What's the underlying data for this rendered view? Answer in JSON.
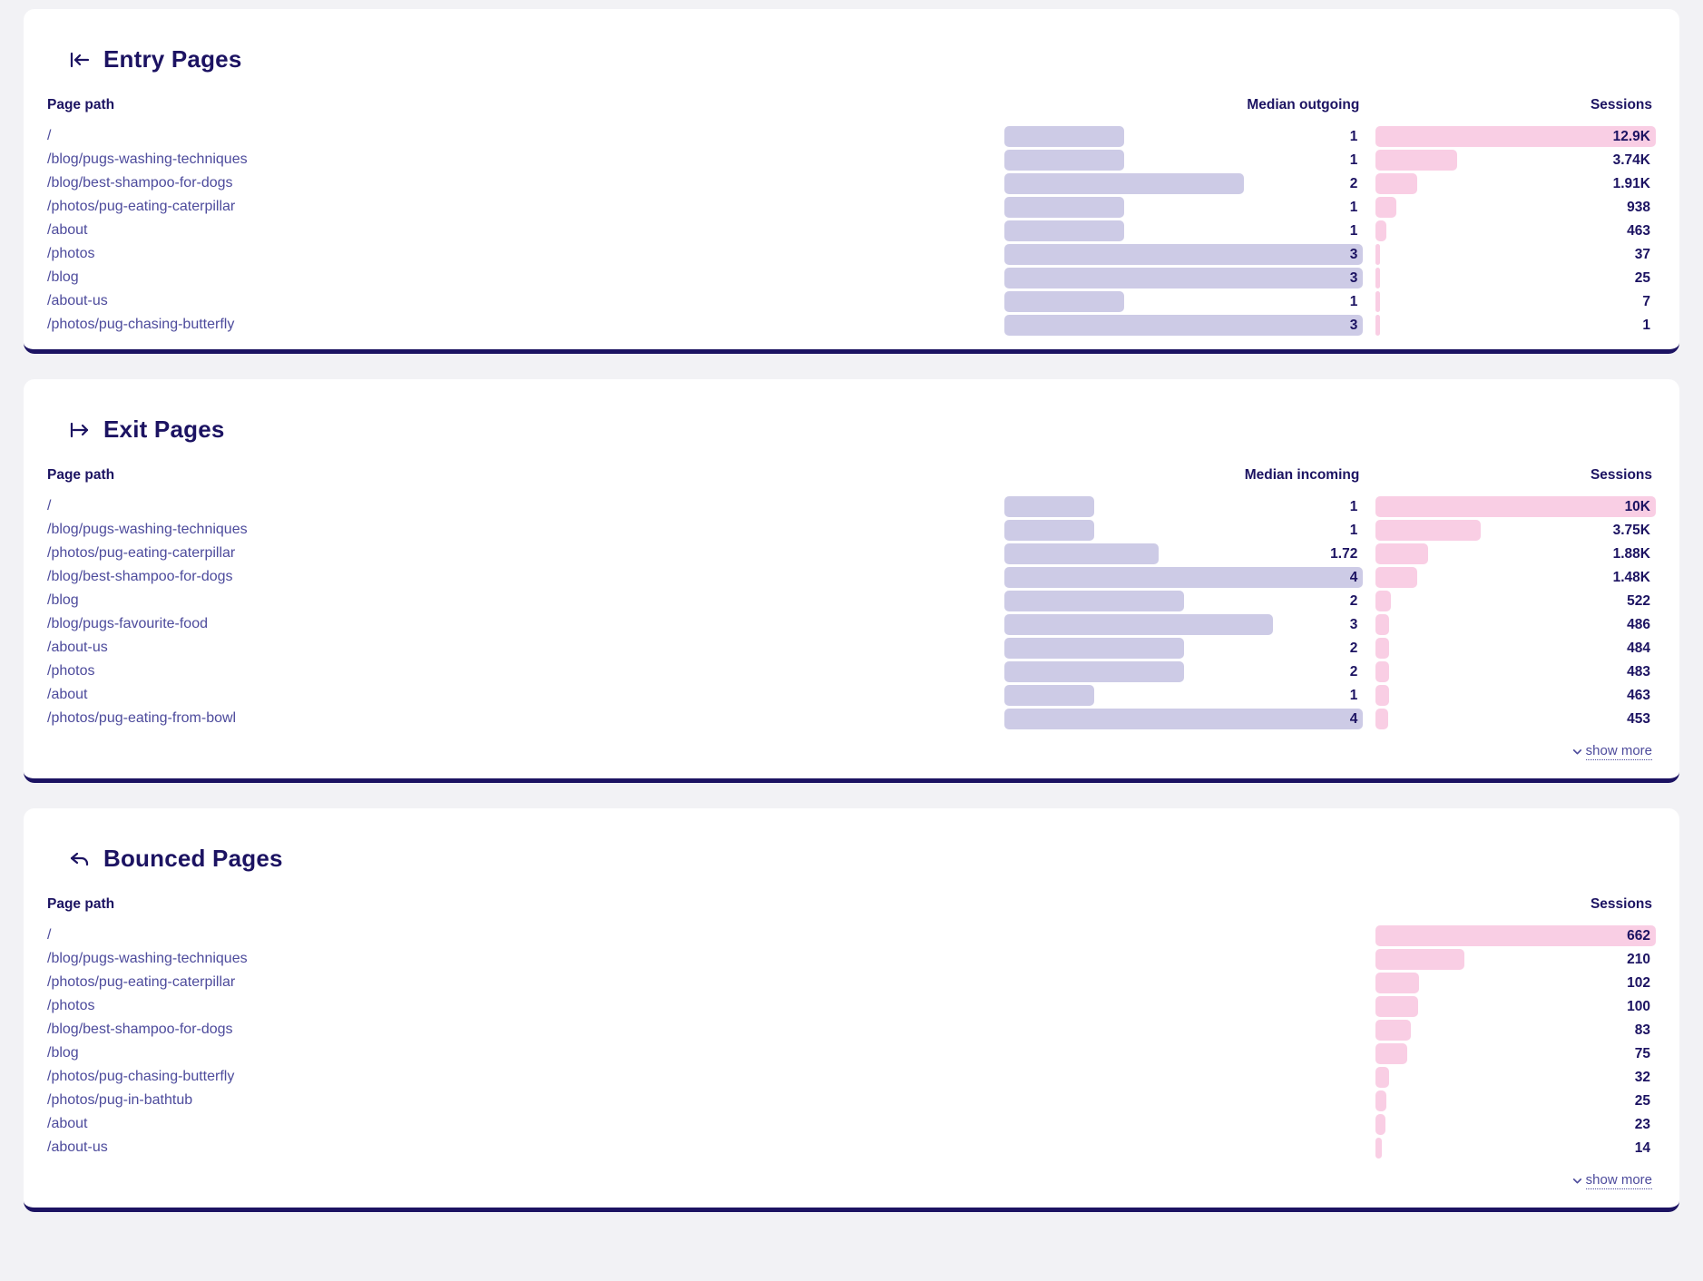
{
  "theme": {
    "page_bg": "#f2f2f5",
    "card_bg": "#ffffff",
    "accent_navy": "#1c1362",
    "path_text": "#4d4b9c",
    "metric_bar": "#cdcbe6",
    "sessions_bar": "#f9cee4",
    "card_bottom_border": "#1c1362"
  },
  "sections": [
    {
      "id": "entry-pages",
      "title": "Entry Pages",
      "icon": "arrow-into-bar-left-icon",
      "columns": {
        "path": "Page path",
        "metric": "Median outgoing",
        "sessions": "Sessions"
      },
      "metric_max": 3,
      "sessions_max": 12900,
      "show_more": null,
      "rows": [
        {
          "path": "/",
          "metric": "1",
          "metric_value": 1,
          "sessions": "12.9K",
          "sessions_value": 12900
        },
        {
          "path": "/blog/pugs-washing-techniques",
          "metric": "1",
          "metric_value": 1,
          "sessions": "3.74K",
          "sessions_value": 3740
        },
        {
          "path": "/blog/best-shampoo-for-dogs",
          "metric": "2",
          "metric_value": 2,
          "sessions": "1.91K",
          "sessions_value": 1910
        },
        {
          "path": "/photos/pug-eating-caterpillar",
          "metric": "1",
          "metric_value": 1,
          "sessions": "938",
          "sessions_value": 938
        },
        {
          "path": "/about",
          "metric": "1",
          "metric_value": 1,
          "sessions": "463",
          "sessions_value": 463
        },
        {
          "path": "/photos",
          "metric": "3",
          "metric_value": 3,
          "sessions": "37",
          "sessions_value": 37
        },
        {
          "path": "/blog",
          "metric": "3",
          "metric_value": 3,
          "sessions": "25",
          "sessions_value": 25
        },
        {
          "path": "/about-us",
          "metric": "1",
          "metric_value": 1,
          "sessions": "7",
          "sessions_value": 7
        },
        {
          "path": "/photos/pug-chasing-butterfly",
          "metric": "3",
          "metric_value": 3,
          "sessions": "1",
          "sessions_value": 1
        }
      ]
    },
    {
      "id": "exit-pages",
      "title": "Exit Pages",
      "icon": "arrow-out-of-bar-right-icon",
      "columns": {
        "path": "Page path",
        "metric": "Median incoming",
        "sessions": "Sessions"
      },
      "metric_max": 4,
      "sessions_max": 10000,
      "show_more": "show more",
      "rows": [
        {
          "path": "/",
          "metric": "1",
          "metric_value": 1,
          "sessions": "10K",
          "sessions_value": 10000
        },
        {
          "path": "/blog/pugs-washing-techniques",
          "metric": "1",
          "metric_value": 1,
          "sessions": "3.75K",
          "sessions_value": 3750
        },
        {
          "path": "/photos/pug-eating-caterpillar",
          "metric": "1.72",
          "metric_value": 1.72,
          "sessions": "1.88K",
          "sessions_value": 1880
        },
        {
          "path": "/blog/best-shampoo-for-dogs",
          "metric": "4",
          "metric_value": 4,
          "sessions": "1.48K",
          "sessions_value": 1480
        },
        {
          "path": "/blog",
          "metric": "2",
          "metric_value": 2,
          "sessions": "522",
          "sessions_value": 522
        },
        {
          "path": "/blog/pugs-favourite-food",
          "metric": "3",
          "metric_value": 3,
          "sessions": "486",
          "sessions_value": 486
        },
        {
          "path": "/about-us",
          "metric": "2",
          "metric_value": 2,
          "sessions": "484",
          "sessions_value": 484
        },
        {
          "path": "/photos",
          "metric": "2",
          "metric_value": 2,
          "sessions": "483",
          "sessions_value": 483
        },
        {
          "path": "/about",
          "metric": "1",
          "metric_value": 1,
          "sessions": "463",
          "sessions_value": 463
        },
        {
          "path": "/photos/pug-eating-from-bowl",
          "metric": "4",
          "metric_value": 4,
          "sessions": "453",
          "sessions_value": 453
        }
      ]
    },
    {
      "id": "bounced-pages",
      "title": "Bounced Pages",
      "icon": "return-arrow-icon",
      "columns": {
        "path": "Page path",
        "metric": null,
        "sessions": "Sessions"
      },
      "metric_max": null,
      "sessions_max": 662,
      "show_more": "show more",
      "rows": [
        {
          "path": "/",
          "sessions": "662",
          "sessions_value": 662
        },
        {
          "path": "/blog/pugs-washing-techniques",
          "sessions": "210",
          "sessions_value": 210
        },
        {
          "path": "/photos/pug-eating-caterpillar",
          "sessions": "102",
          "sessions_value": 102
        },
        {
          "path": "/photos",
          "sessions": "100",
          "sessions_value": 100
        },
        {
          "path": "/blog/best-shampoo-for-dogs",
          "sessions": "83",
          "sessions_value": 83
        },
        {
          "path": "/blog",
          "sessions": "75",
          "sessions_value": 75
        },
        {
          "path": "/photos/pug-chasing-butterfly",
          "sessions": "32",
          "sessions_value": 32
        },
        {
          "path": "/photos/pug-in-bathtub",
          "sessions": "25",
          "sessions_value": 25
        },
        {
          "path": "/about",
          "sessions": "23",
          "sessions_value": 23
        },
        {
          "path": "/about-us",
          "sessions": "14",
          "sessions_value": 14
        }
      ]
    }
  ]
}
